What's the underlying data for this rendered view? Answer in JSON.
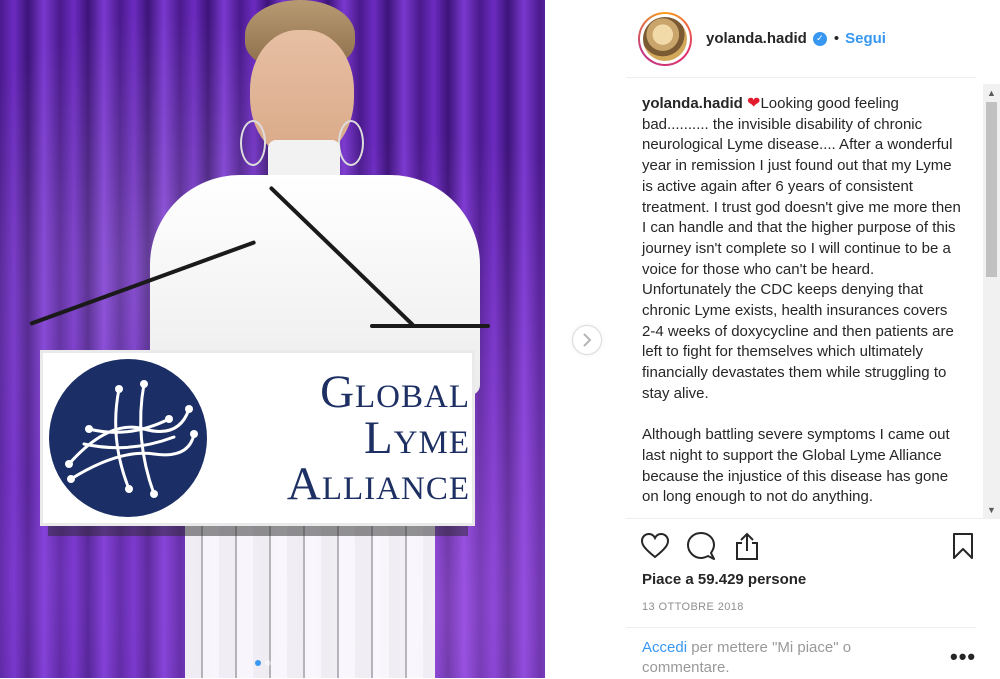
{
  "post": {
    "username": "yolanda.hadid",
    "follow_label": "Segui",
    "separator": "•",
    "sign": {
      "line1": "Global",
      "line2": "Lyme",
      "line3": "Alliance"
    },
    "caption_username": "yolanda.hadid",
    "caption_heart": "❤",
    "caption_text": "Looking good feeling bad.......... the invisible disability of chronic neurological Lyme disease.... After a wonderful year in remission I just found out that my Lyme is active again after 6 years of consistent treatment. I trust god doesn't give me more then I can handle and that the higher purpose of this journey isn't complete so I will continue to be a voice for those who can't be heard.\nUnfortunately the CDC keeps denying that chronic Lyme exists, health insurances covers 2-4 weeks of doxycycline and then patients are left to fight for themselves which ultimately financially devastates them while struggling to stay alive.\n\nAlthough battling severe symptoms I came out last night to support the Global Lyme Alliance because the injustice of this disease has gone on long enough to not do anything.",
    "likes": "Piace a 59.429 persone",
    "date": "13 OTTOBRE 2018",
    "login_link": "Accedi",
    "login_rest": " per mettere \"Mi piace\" o commentare.",
    "more_icon": "•••",
    "carousel_next_icon": "chevron-right-icon",
    "icons": [
      "heart-icon",
      "comment-icon",
      "share-icon",
      "bookmark-icon"
    ]
  },
  "colors": {
    "accent": "#3897f0",
    "text": "#262626",
    "muted": "#8e8e8e",
    "heart": "#e31b2c",
    "sign_blue": "#1d2f63"
  }
}
